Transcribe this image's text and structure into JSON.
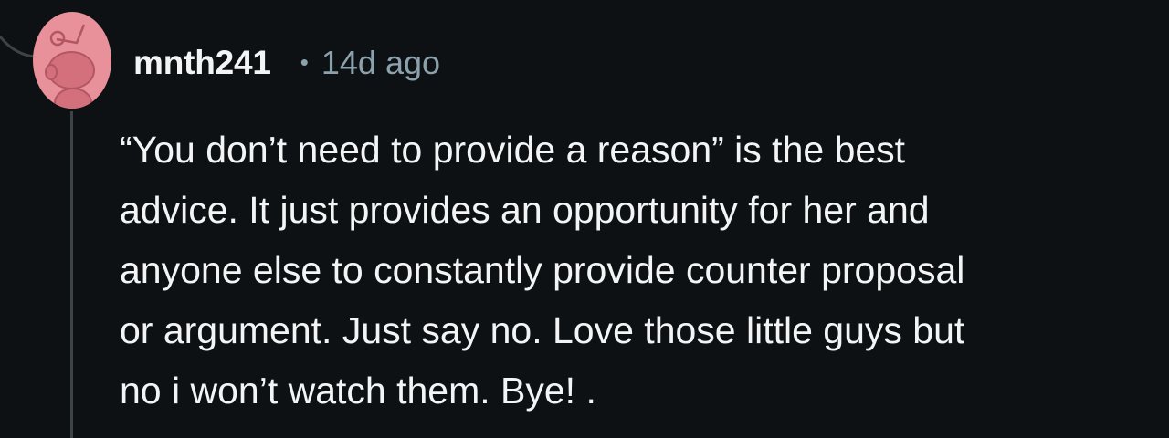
{
  "comment": {
    "username": "mnth241",
    "separator": "•",
    "timestamp": "14d ago",
    "body_lines": [
      "“You don’t need to provide a reason” is the best",
      "advice. It just provides an opportunity for her and",
      "anyone else to constantly provide counter proposal",
      "or argument. Just say no. Love those little guys but",
      "no i won’t watch them. Bye! ."
    ]
  },
  "icons": {
    "avatar": "snoo-avatar-icon"
  },
  "colors": {
    "background": "#0e1113",
    "text": "#f2f4f5",
    "meta_text": "#8ba2ad",
    "thread_line": "#3e4345",
    "avatar_bg": "#e8919a"
  }
}
